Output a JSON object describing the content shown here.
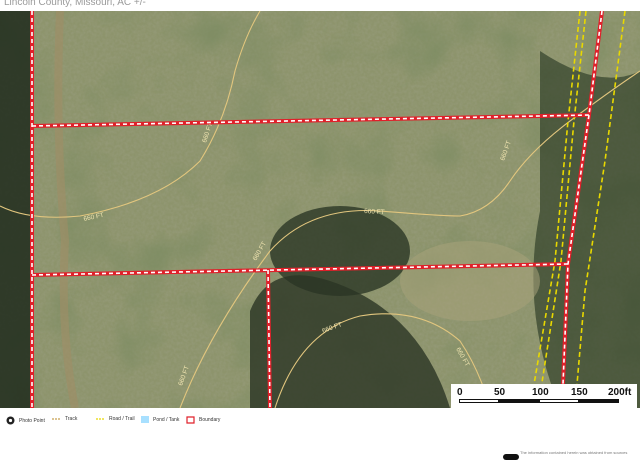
{
  "header": {
    "title": "Lincoln County, Missouri,  AC +/-"
  },
  "map": {
    "contour_labels": [
      "660 FT",
      "660 FT",
      "660 FT",
      "660 FT",
      "660 FT",
      "660 FT",
      "660 FT",
      "660 FT"
    ],
    "colors": {
      "boundary": "#e0202a",
      "road_trail": "#e8d800",
      "track": "#c8a050",
      "contour": "#d9c080",
      "pond_tank": "#a8e0ff"
    }
  },
  "scale_bar": {
    "labels": [
      "0",
      "50",
      "100",
      "150",
      "200ft"
    ]
  },
  "legend": {
    "items": [
      {
        "label": "Photo Point",
        "icon": "camera-icon"
      },
      {
        "label": "Track",
        "icon": "track-line-icon"
      },
      {
        "label": "Road / Trail",
        "icon": "road-line-icon"
      },
      {
        "label": "Pond / Tank",
        "icon": "pond-swatch-icon"
      },
      {
        "label": "Boundary",
        "icon": "boundary-icon"
      }
    ],
    "disclaimer": "The information contained herein was obtained from sources"
  }
}
